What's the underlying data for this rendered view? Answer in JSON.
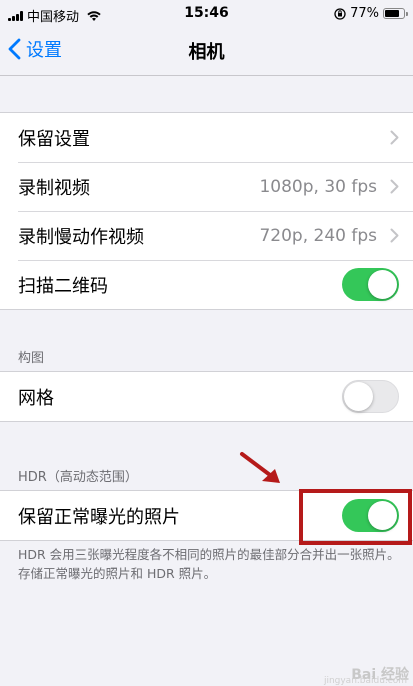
{
  "status_bar": {
    "carrier": "中国移动",
    "time": "15:46",
    "battery": "77%",
    "battery_level": 0.77,
    "icons": [
      "signal-icon",
      "wifi-icon",
      "orientation-lock-icon",
      "battery-icon"
    ]
  },
  "nav": {
    "back_label": "设置",
    "title": "相机"
  },
  "group1": {
    "rows": [
      {
        "label": "保留设置",
        "value": "",
        "type": "chevron"
      },
      {
        "label": "录制视频",
        "value": "1080p, 30 fps",
        "type": "chevron"
      },
      {
        "label": "录制慢动作视频",
        "value": "720p, 240 fps",
        "type": "chevron"
      },
      {
        "label": "扫描二维码",
        "type": "toggle",
        "on": true
      }
    ]
  },
  "composition": {
    "header": "构图",
    "rows": [
      {
        "label": "网格",
        "type": "toggle",
        "on": false
      }
    ]
  },
  "hdr": {
    "header": "HDR（高动态范围）",
    "rows": [
      {
        "label": "保留正常曝光的照片",
        "type": "toggle",
        "on": true
      }
    ],
    "footer": "HDR 会用三张曝光程度各不相同的照片的最佳部分合并出一张照片。存储正常曝光的照片和 HDR 照片。"
  },
  "annotation": {
    "highlight_color": "#b51a1a"
  },
  "colors": {
    "accent": "#007aff",
    "toggle_on": "#34c759",
    "background": "#f2f2f7"
  },
  "watermark": {
    "text": "Bai 经验",
    "subtext": "jingyan.baidu.com"
  }
}
